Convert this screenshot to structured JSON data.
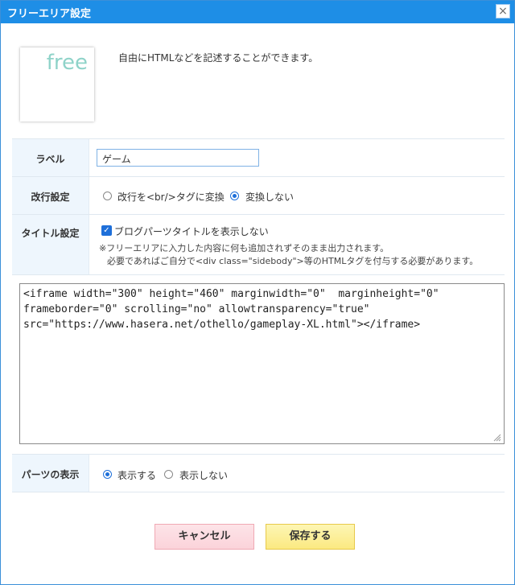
{
  "dialog": {
    "title": "フリーエリア設定",
    "close_glyph": "×"
  },
  "header": {
    "logo_text": "free",
    "description": "自由にHTMLなどを記述することができます。"
  },
  "label_row": {
    "label": "ラベル",
    "value": "ゲーム"
  },
  "linebreak_row": {
    "label": "改行設定",
    "options": [
      {
        "text": "改行を<br/>タグに変換",
        "selected": false
      },
      {
        "text": "変換しない",
        "selected": true
      }
    ]
  },
  "title_row": {
    "label": "タイトル設定",
    "checkbox_label": "ブログパーツタイトルを表示しない",
    "checked": true,
    "note_line1": "※フリーエリアに入力した内容に何も追加されずそのまま出力されます。",
    "note_line2": "必要であればご自分で<div class=\"sidebody\">等のHTMLタグを付与する必要があります。"
  },
  "code": {
    "value": "<iframe width=\"300\" height=\"460\" marginwidth=\"0\"  marginheight=\"0\"\nframeborder=\"0\" scrolling=\"no\" allowtransparency=\"true\"\nsrc=\"https://www.hasera.net/othello/gameplay-XL.html\"></iframe>"
  },
  "display_row": {
    "label": "パーツの表示",
    "options": [
      {
        "text": "表示する",
        "selected": true
      },
      {
        "text": "表示しない",
        "selected": false
      }
    ]
  },
  "buttons": {
    "cancel": "キャンセル",
    "save": "保存する"
  },
  "colors": {
    "titlebar": "#1e8ee6",
    "label_bg": "#eef6fd",
    "radio_selected": "#1e6fd9"
  }
}
